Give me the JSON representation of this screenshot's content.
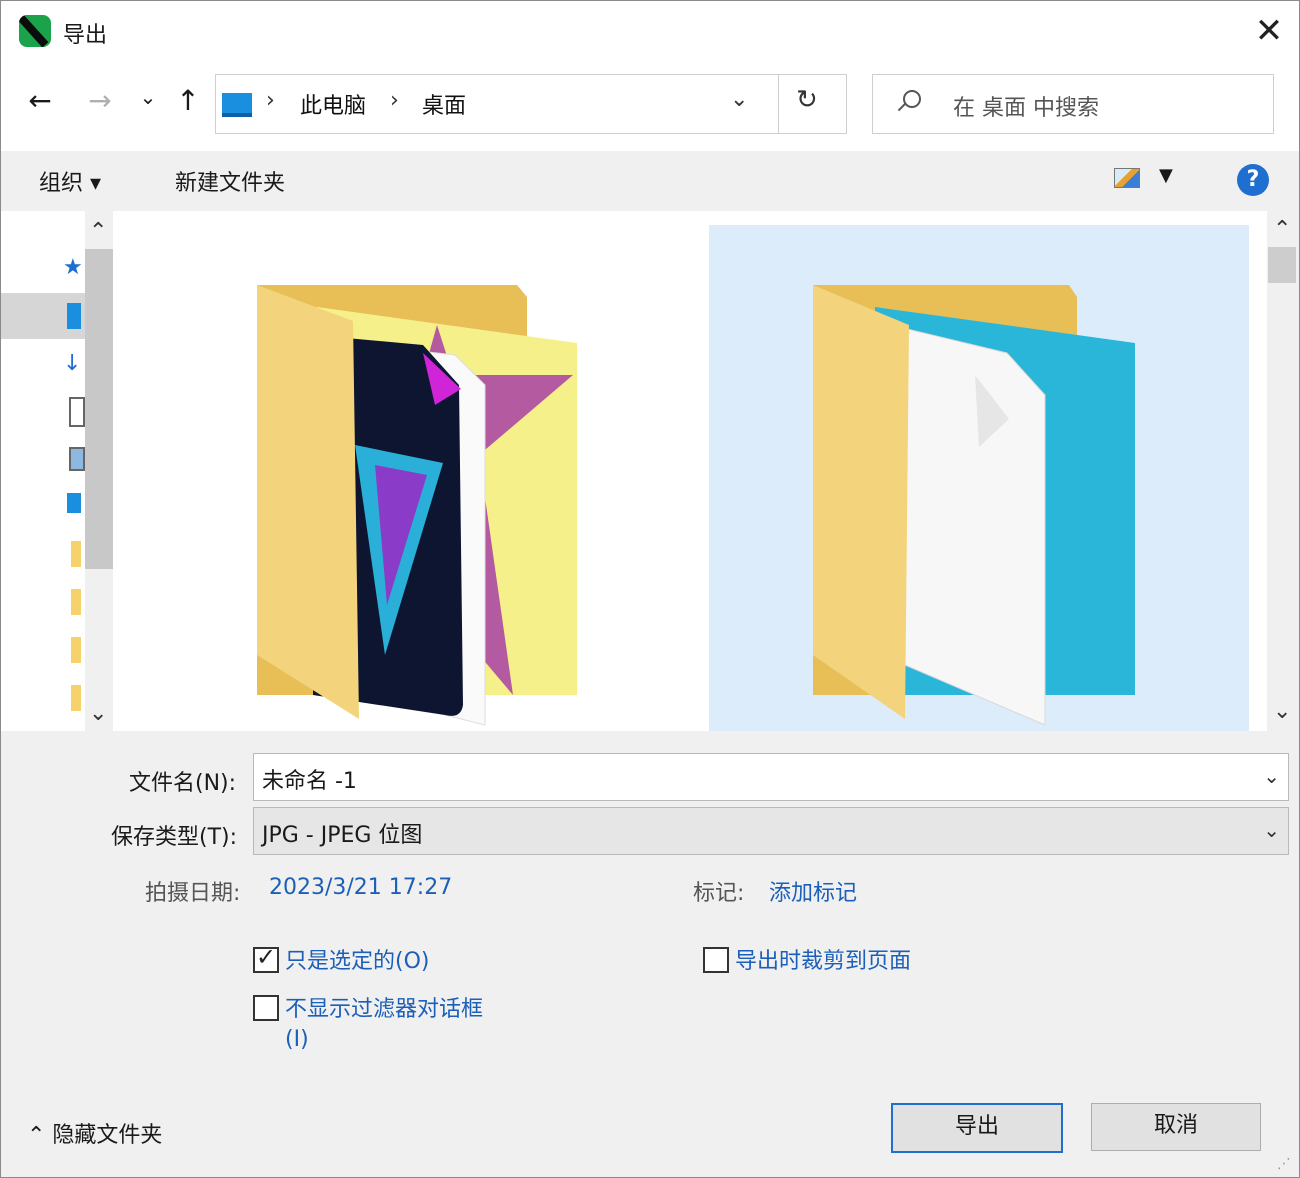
{
  "window": {
    "title": "导出",
    "close_glyph": "✕"
  },
  "nav": {
    "back": "←",
    "forward": "→",
    "recent": "⌄",
    "up": "↑",
    "breadcrumb": [
      "此电脑",
      "桌面"
    ],
    "crumb_separator": "›",
    "dropdown": "⌄",
    "refresh": "↻",
    "search_placeholder": "在 桌面 中搜索"
  },
  "toolbar": {
    "organize": "组织 ▾",
    "new_folder": "新建文件夹",
    "view_dropdown": "▼",
    "help": "?"
  },
  "form": {
    "filename_label": "文件名(N):",
    "filename_value": "未命名 -1",
    "filetype_label": "保存类型(T):",
    "filetype_value": "JPG - JPEG 位图",
    "date_label": "拍摄日期:",
    "date_value": "2023/3/21 17:27",
    "tags_label": "标记:",
    "tags_value": "添加标记",
    "dropdown_glyph": "⌄"
  },
  "options": {
    "selected_only": {
      "label": "只是选定的(O)",
      "checked": true
    },
    "crop_to_page": {
      "label": "导出时裁剪到页面",
      "checked": false
    },
    "no_filter_dialog": {
      "label": "不显示过滤器对话框",
      "label2": "(I)",
      "checked": false
    },
    "check_glyph": "✓"
  },
  "footer": {
    "hide_folders": "⌃  隐藏文件夹",
    "export": "导出",
    "cancel": "取消"
  },
  "colors": {
    "accent": "#1f6fd0",
    "link": "#1c5fb8",
    "selection": "#dcecfb",
    "folder": "#f5d26b"
  }
}
